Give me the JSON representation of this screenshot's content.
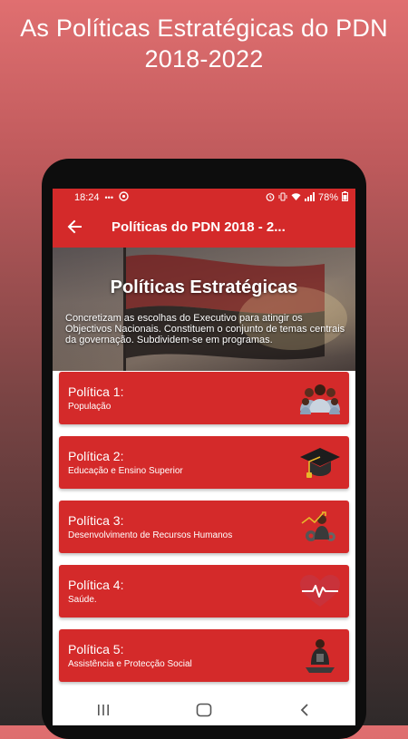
{
  "promo": {
    "title": "As Políticas Estratégicas do PDN\n2018-2022"
  },
  "status_bar": {
    "time": "18:24",
    "battery": "78%",
    "icons_left": [
      "notification-dots-icon",
      "app-notification-icon"
    ],
    "icons_right": [
      "alarm-icon",
      "vibrate-icon",
      "wifi-icon",
      "signal-icon",
      "battery-icon"
    ]
  },
  "app_bar": {
    "title": "Políticas do PDN 2018 - 2..."
  },
  "hero": {
    "title": "Políticas Estratégicas",
    "description": "Concretizam as escolhas do Executivo para atingir os Objectivos Nacionais. Constituem o conjunto de temas centrais da governação. Subdividem-se em programas."
  },
  "policies": [
    {
      "title": "Política 1:",
      "subtitle": "População",
      "icon": "population-icon"
    },
    {
      "title": "Política 2:",
      "subtitle": "Educação e Ensino Superior",
      "icon": "graduation-cap-icon"
    },
    {
      "title": "Política 3:",
      "subtitle": "Desenvolvimento de Recursos Humanos",
      "icon": "human-resources-icon"
    },
    {
      "title": "Política 4:",
      "subtitle": "Saúde.",
      "icon": "heartbeat-icon"
    },
    {
      "title": "Política 5:",
      "subtitle": "Assistência e Protecção Social",
      "icon": "social-assistance-icon"
    }
  ],
  "colors": {
    "primary": "#d42a2a",
    "text_on_primary": "#ffffff"
  }
}
